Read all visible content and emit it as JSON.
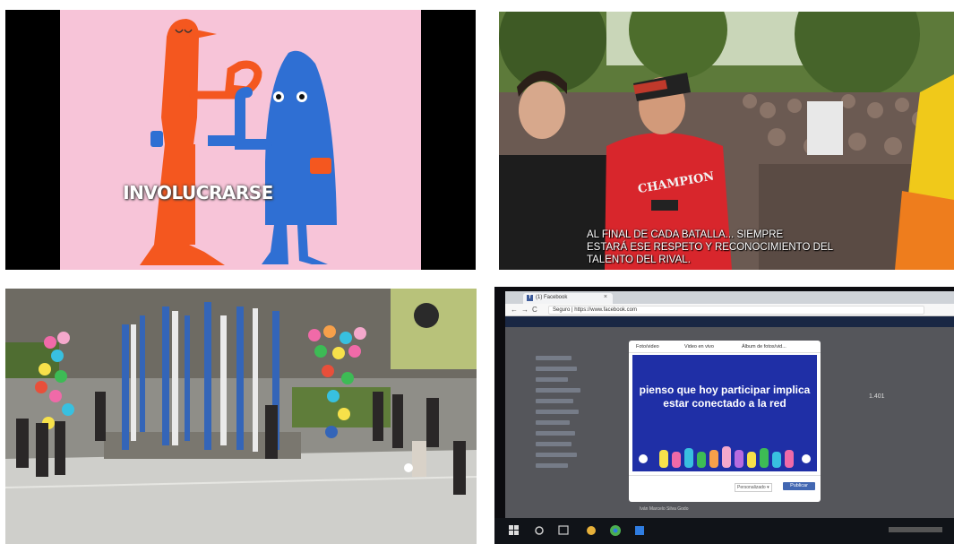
{
  "panels": {
    "animation": {
      "caption": "INVOLUCRARSE",
      "colors": {
        "background": "#f7c4d8",
        "orange": "#f4571f",
        "blue": "#2f6fd3"
      }
    },
    "rap_battle": {
      "subtitle_lines": [
        "AL FINAL DE CADA BATALLA... SIEMPRE",
        "ESTARÁ ESE RESPETO Y RECONOCIMIENTO DEL",
        "TALENTO DEL RIVAL."
      ],
      "shirt_text": "CHAMPION"
    },
    "courtyard": {
      "colors": {
        "pavement": "#cfcfcb",
        "balloons": "#f06aa8"
      }
    },
    "facebook": {
      "tab_title": "(1) Facebook",
      "tab_icon": "f",
      "tab_close": "×",
      "url": "Seguro | https://www.facebook.com",
      "composer_tabs": [
        "Foto/video",
        "Video en vivo",
        "Álbum de fotos/vid..."
      ],
      "post_text": "pienso que hoy participar implica estar conectado a la red",
      "audience_label": "Personalizado ▾",
      "publish_label": "Publicar",
      "like_count": "1.401",
      "user_name": "Iván Marcelo Silva Godo",
      "colors": {
        "post_bg": "#1f2fa6",
        "brand": "#4267b2"
      }
    }
  }
}
